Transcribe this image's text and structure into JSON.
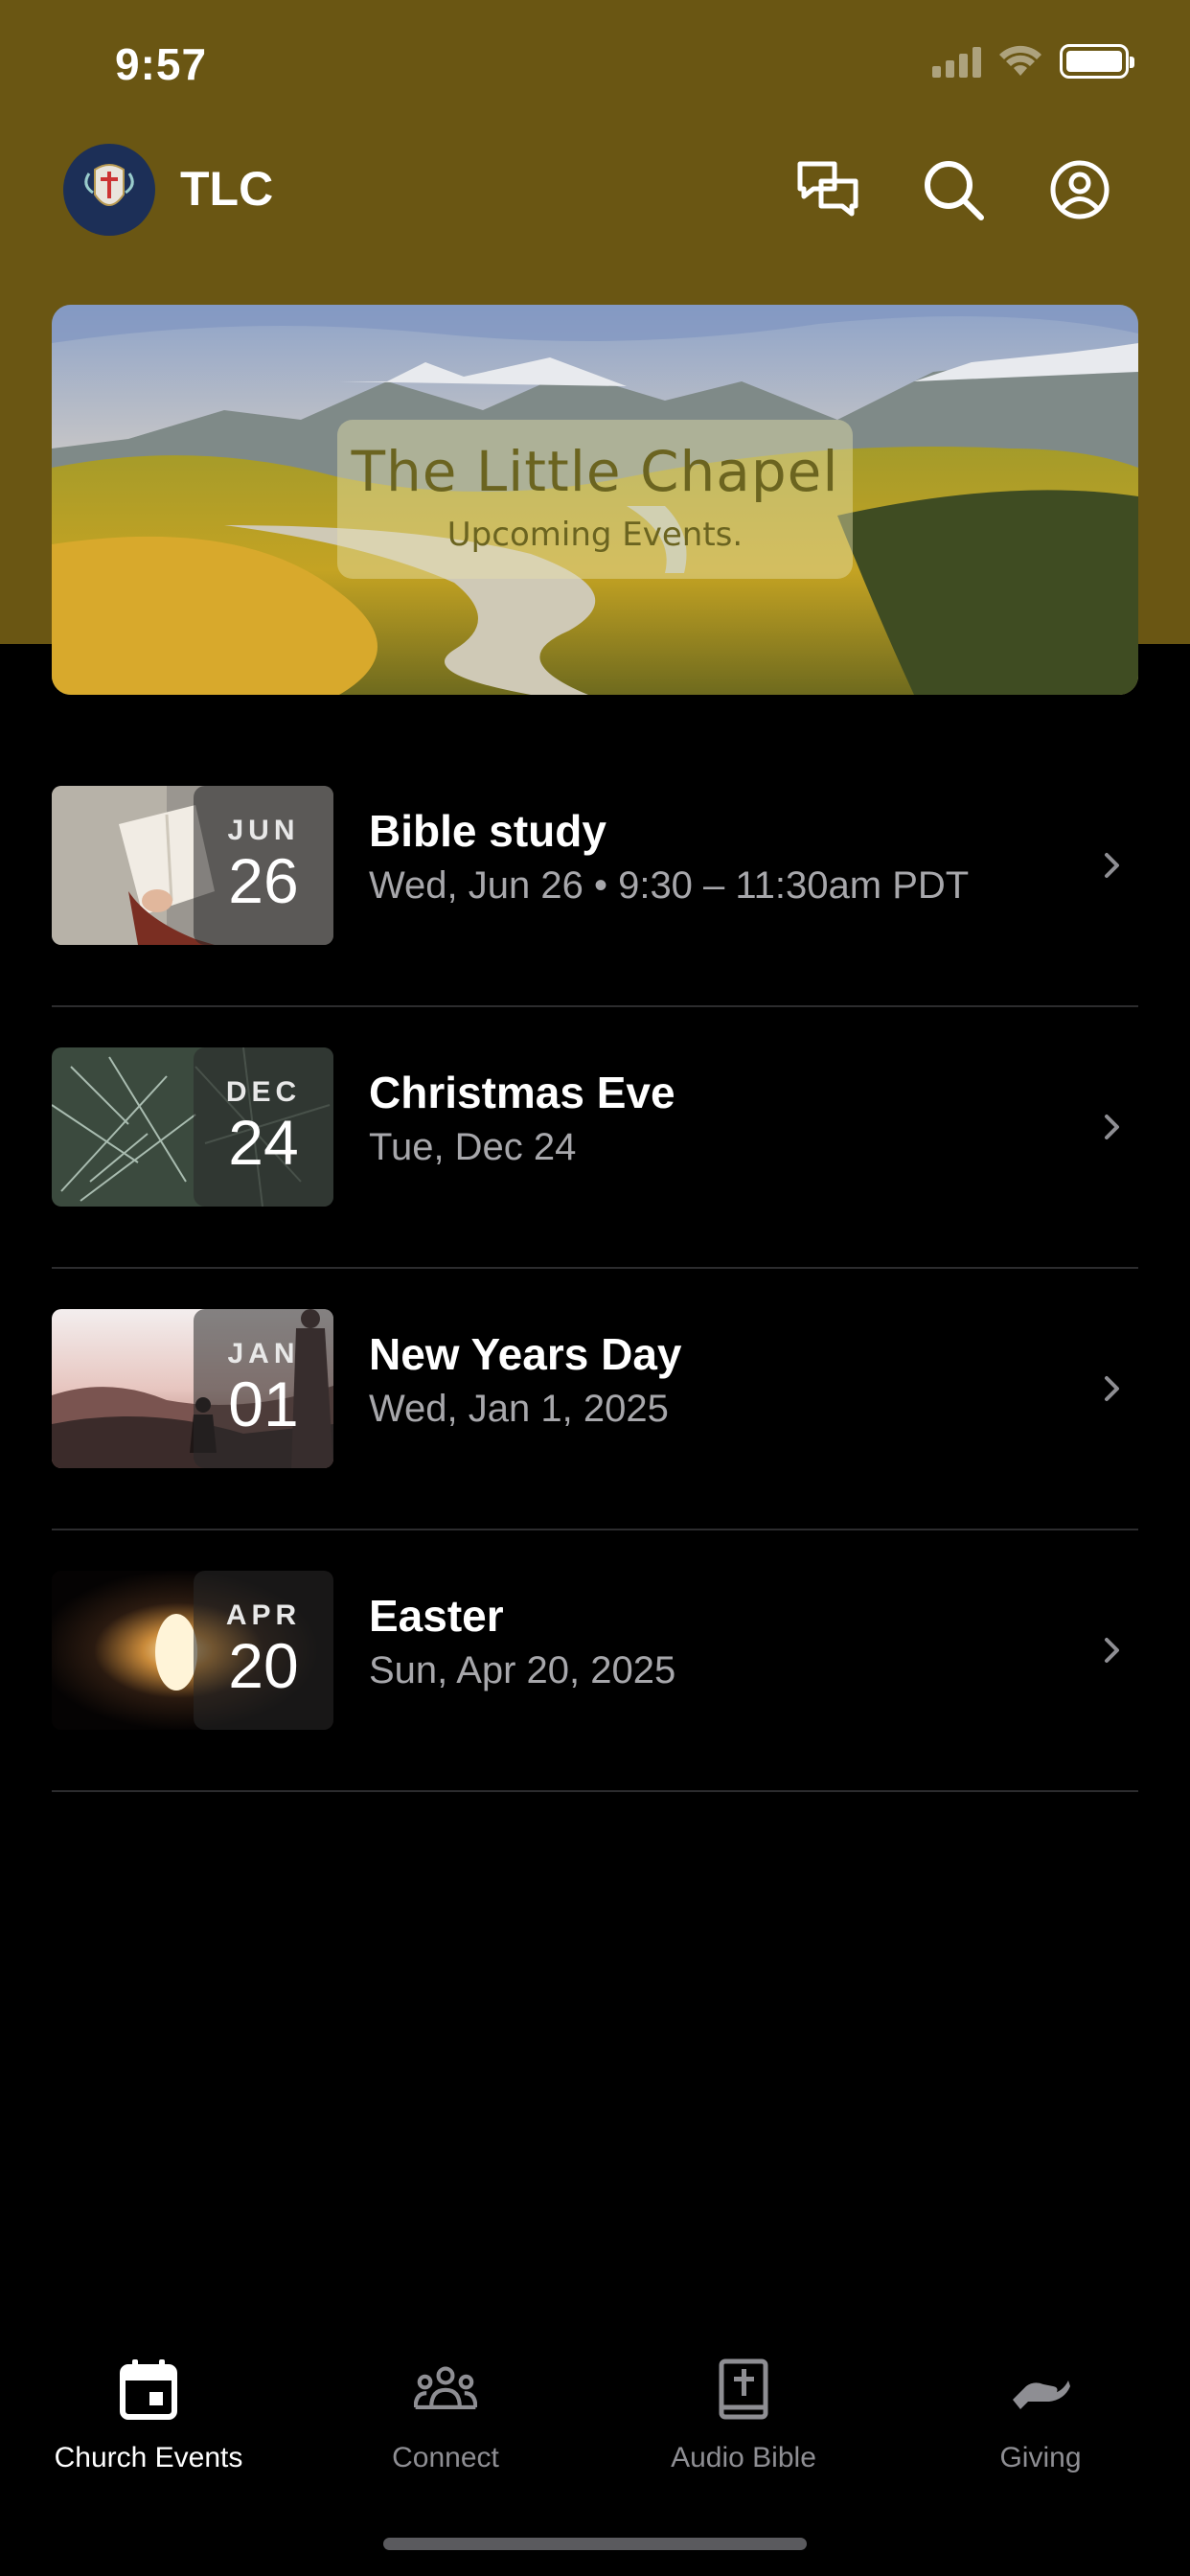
{
  "status_bar": {
    "time": "9:57"
  },
  "header": {
    "app_name": "TLC",
    "icons": [
      "chat-bubbles-icon",
      "search-icon",
      "profile-icon"
    ],
    "accent_color": "#6a5613"
  },
  "banner": {
    "title": "The Little Chapel",
    "subtitle": "Upcoming Events."
  },
  "events": [
    {
      "month": "JUN",
      "day": "26",
      "title": "Bible study",
      "subtitle": "Wed, Jun 26 • 9:30 – 11:30am PDT"
    },
    {
      "month": "DEC",
      "day": "24",
      "title": "Christmas Eve",
      "subtitle": "Tue, Dec 24"
    },
    {
      "month": "JAN",
      "day": "01",
      "title": "New Years Day",
      "subtitle": "Wed, Jan 1, 2025"
    },
    {
      "month": "APR",
      "day": "20",
      "title": "Easter",
      "subtitle": "Sun, Apr 20, 2025"
    }
  ],
  "tab_bar": {
    "tabs": [
      {
        "label": "Church Events",
        "icon": "calendar-icon",
        "active": true
      },
      {
        "label": "Connect",
        "icon": "group-icon",
        "active": false
      },
      {
        "label": "Audio Bible",
        "icon": "bible-icon",
        "active": false
      },
      {
        "label": "Giving",
        "icon": "giving-hand-icon",
        "active": false
      }
    ]
  }
}
